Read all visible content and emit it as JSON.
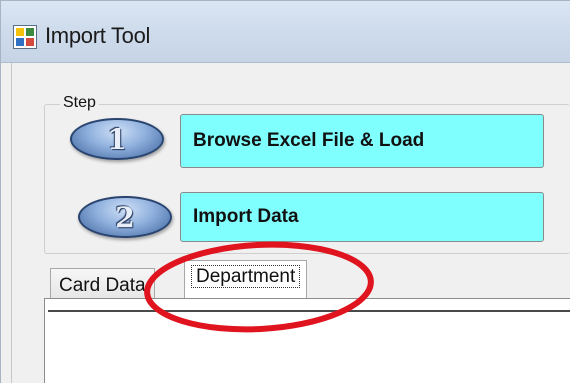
{
  "window": {
    "title": "Import Tool"
  },
  "step_group": {
    "label": "Step",
    "steps": [
      {
        "number": "1",
        "button_label": "Browse Excel File & Load"
      },
      {
        "number": "2",
        "button_label": "Import Data"
      }
    ]
  },
  "tabs": [
    {
      "label": "Card Data",
      "selected": false
    },
    {
      "label": "Department",
      "selected": true
    }
  ],
  "colors": {
    "button_fill": "#80ffff",
    "annotation_circle": "#e0141e",
    "step_oval": "#6b8cc0"
  }
}
